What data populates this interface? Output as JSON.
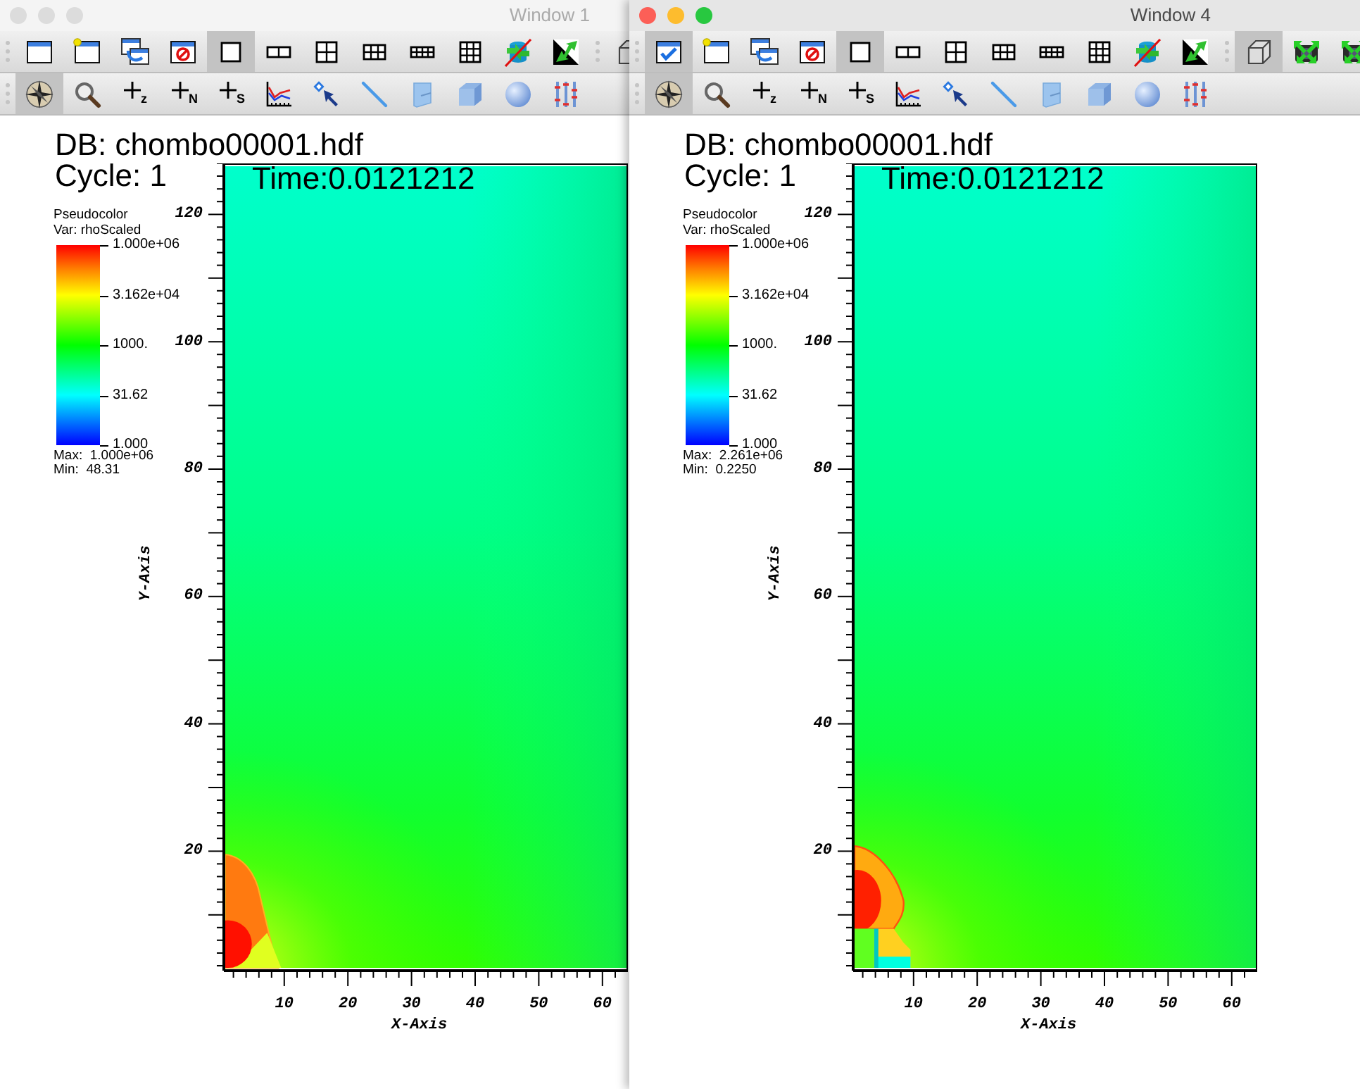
{
  "windows": [
    {
      "title": "Window 1",
      "active": false,
      "toolbar_rows": [
        [
          [
            {
              "kind": "window",
              "checked": false,
              "selected": false
            },
            {
              "kind": "new-window",
              "selected": false
            },
            {
              "kind": "copy-windows",
              "selected": false
            },
            {
              "kind": "clear-window",
              "selected": false
            },
            {
              "kind": "layout-1x1",
              "selected": true
            },
            {
              "kind": "layout-1x2",
              "selected": false
            },
            {
              "kind": "layout-2x2",
              "selected": false
            },
            {
              "kind": "layout-2x3",
              "selected": false
            },
            {
              "kind": "layout-2x4",
              "selected": false
            },
            {
              "kind": "layout-3x3",
              "selected": false
            },
            {
              "kind": "lock-view",
              "selected": false
            },
            {
              "kind": "arrows",
              "selected": false
            }
          ],
          [
            {
              "kind": "cube",
              "selected": false
            }
          ]
        ],
        [
          [
            {
              "kind": "compass",
              "selected": true
            },
            {
              "kind": "zoom",
              "selected": false
            },
            {
              "kind": "pick",
              "label": "z",
              "selected": false
            },
            {
              "kind": "pick",
              "label": "N",
              "selected": false
            },
            {
              "kind": "pick",
              "label": "S",
              "selected": false
            },
            {
              "kind": "curve",
              "selected": false
            },
            {
              "kind": "point-pick",
              "selected": false
            },
            {
              "kind": "line",
              "selected": false
            },
            {
              "kind": "plane",
              "selected": false
            },
            {
              "kind": "box",
              "selected": false
            },
            {
              "kind": "sphere",
              "selected": false
            },
            {
              "kind": "sliders",
              "selected": false
            }
          ]
        ]
      ],
      "annotations": {
        "database": "DB: chombo00001.hdf",
        "cycle": "Cycle: 1",
        "time": "Time:0.0121212"
      },
      "legend": {
        "plot": "Pseudocolor",
        "variable": "Var: rhoScaled",
        "scale_labels": [
          "1.000e+06",
          "3.162e+04",
          "1000.",
          "31.62",
          "1.000"
        ],
        "max": "Max:  1.000e+06",
        "min": "Min:  48.31"
      },
      "y_axis": {
        "title": "Y-Axis",
        "ticks": [
          "120",
          "100",
          "80",
          "60",
          "40",
          "20"
        ]
      },
      "x_axis": {
        "title": "X-Axis",
        "ticks": [
          "10",
          "20",
          "30",
          "40",
          "50",
          "60"
        ]
      }
    },
    {
      "title": "Window 4",
      "active": true,
      "toolbar_rows": [
        [
          [
            {
              "kind": "window",
              "checked": true,
              "selected": true
            },
            {
              "kind": "new-window",
              "selected": false
            },
            {
              "kind": "copy-windows",
              "selected": false
            },
            {
              "kind": "clear-window",
              "selected": false
            },
            {
              "kind": "layout-1x1",
              "selected": true
            },
            {
              "kind": "layout-1x2",
              "selected": false
            },
            {
              "kind": "layout-2x2",
              "selected": false
            },
            {
              "kind": "layout-2x3",
              "selected": false
            },
            {
              "kind": "layout-2x4",
              "selected": false
            },
            {
              "kind": "layout-3x3",
              "selected": false
            },
            {
              "kind": "lock-view",
              "selected": false
            },
            {
              "kind": "arrows",
              "selected": false
            }
          ],
          [
            {
              "kind": "cube",
              "selected": true
            },
            {
              "kind": "camera-arrows",
              "selected": false
            },
            {
              "kind": "camera-arrows",
              "selected": false
            }
          ]
        ],
        [
          [
            {
              "kind": "compass",
              "selected": true
            },
            {
              "kind": "zoom",
              "selected": false
            },
            {
              "kind": "pick",
              "label": "z",
              "selected": false
            },
            {
              "kind": "pick",
              "label": "N",
              "selected": false
            },
            {
              "kind": "pick",
              "label": "S",
              "selected": false
            },
            {
              "kind": "curve",
              "selected": false
            },
            {
              "kind": "point-pick",
              "selected": false
            },
            {
              "kind": "line",
              "selected": false
            },
            {
              "kind": "plane",
              "selected": false
            },
            {
              "kind": "box",
              "selected": false
            },
            {
              "kind": "sphere",
              "selected": false
            },
            {
              "kind": "sliders",
              "selected": false
            }
          ]
        ]
      ],
      "annotations": {
        "database": "DB: chombo00001.hdf",
        "cycle": "Cycle: 1",
        "time": "Time:0.0121212"
      },
      "legend": {
        "plot": "Pseudocolor",
        "variable": "Var: rhoScaled",
        "scale_labels": [
          "1.000e+06",
          "3.162e+04",
          "1000.",
          "31.62",
          "1.000"
        ],
        "max": "Max:  2.261e+06",
        "min": "Min:  0.2250"
      },
      "y_axis": {
        "title": "Y-Axis",
        "ticks": [
          "120",
          "100",
          "80",
          "60",
          "40",
          "20"
        ]
      },
      "x_axis": {
        "title": "X-Axis",
        "ticks": [
          "10",
          "20",
          "30",
          "40",
          "50",
          "60"
        ]
      }
    }
  ]
}
